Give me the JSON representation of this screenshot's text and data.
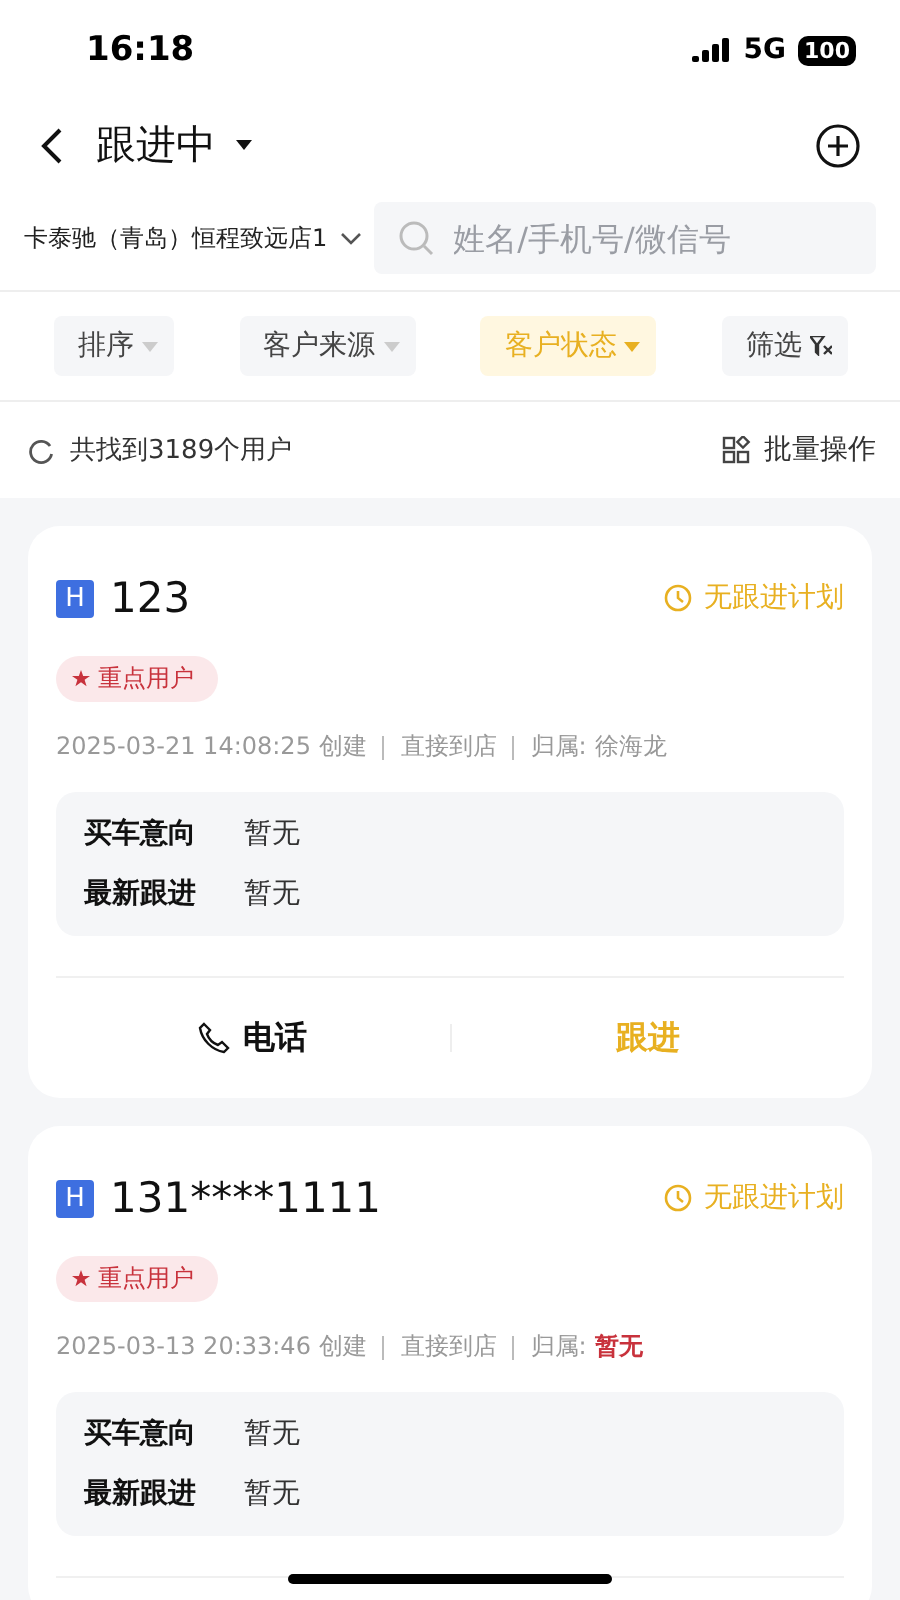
{
  "status_bar": {
    "time": "16:18",
    "network": "5G",
    "battery": "100"
  },
  "nav": {
    "title": "跟进中"
  },
  "store": {
    "name": "卡泰驰（青岛）恒程致远店1"
  },
  "search": {
    "placeholder": "姓名/手机号/微信号"
  },
  "filters": [
    {
      "label": "排序",
      "selected": false,
      "kind": "dropdown"
    },
    {
      "label": "客户来源",
      "selected": false,
      "kind": "dropdown"
    },
    {
      "label": "客户状态",
      "selected": true,
      "kind": "dropdown"
    },
    {
      "label": "筛选",
      "selected": false,
      "kind": "filter"
    }
  ],
  "summary": {
    "count_text": "共找到3189个用户",
    "batch": "批量操作"
  },
  "customers": [
    {
      "badge": "H",
      "name": "123",
      "plan": "无跟进计划",
      "tag": "重点用户",
      "created": "2025-03-21 14:08:25 创建",
      "source": "直接到店",
      "owner_label": "归属:",
      "owner": "徐海龙",
      "owner_unassigned": false,
      "details": [
        {
          "label": "买车意向",
          "value": "暂无"
        },
        {
          "label": "最新跟进",
          "value": "暂无"
        }
      ],
      "actions": [
        {
          "label": "电话",
          "kind": "call"
        },
        {
          "label": "跟进",
          "kind": "follow"
        }
      ]
    },
    {
      "badge": "H",
      "name": "131****1111",
      "plan": "无跟进计划",
      "tag": "重点用户",
      "created": "2025-03-13 20:33:46 创建",
      "source": "直接到店",
      "owner_label": "归属:",
      "owner": "暂无",
      "owner_unassigned": true,
      "details": [
        {
          "label": "买车意向",
          "value": "暂无"
        },
        {
          "label": "最新跟进",
          "value": "暂无"
        }
      ]
    }
  ]
}
